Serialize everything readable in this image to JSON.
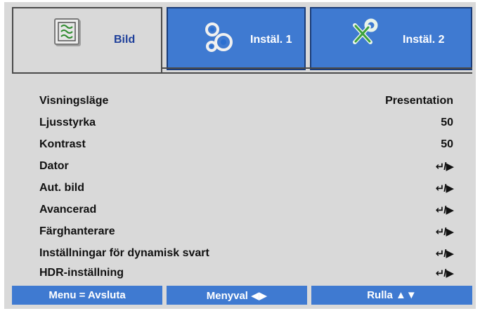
{
  "tabs": [
    {
      "id": "bild",
      "label": "Bild",
      "icon": "picture-icon",
      "active": true
    },
    {
      "id": "instal1",
      "label": "Instäl. 1",
      "icon": "gears-icon",
      "active": false
    },
    {
      "id": "instal2",
      "label": "Instäl. 2",
      "icon": "tools-icon",
      "active": false
    }
  ],
  "menu": {
    "items": [
      {
        "label": "Visningsläge",
        "value": "Presentation"
      },
      {
        "label": "Ljusstyrka",
        "value": "50"
      },
      {
        "label": "Kontrast",
        "value": "50"
      },
      {
        "label": "Dator",
        "value": "↵/▶"
      },
      {
        "label": "Aut. bild",
        "value": "↵/▶"
      },
      {
        "label": "Avancerad",
        "value": "↵/▶"
      },
      {
        "label": "Färghanterare",
        "value": "↵/▶"
      },
      {
        "label": "Inställningar för dynamisk svart",
        "value": "↵/▶"
      },
      {
        "label": "HDR-inställning",
        "value": "↵/▶"
      }
    ]
  },
  "footer": {
    "menu_exit": "Menu = Avsluta",
    "menu_select": "Menyval ◀▶",
    "scroll": "Rulla ▲▼"
  },
  "colors": {
    "accent_blue": "#3f7ad1",
    "panel_gray": "#d9d9d9",
    "active_tab_text": "#1e3f9a"
  }
}
